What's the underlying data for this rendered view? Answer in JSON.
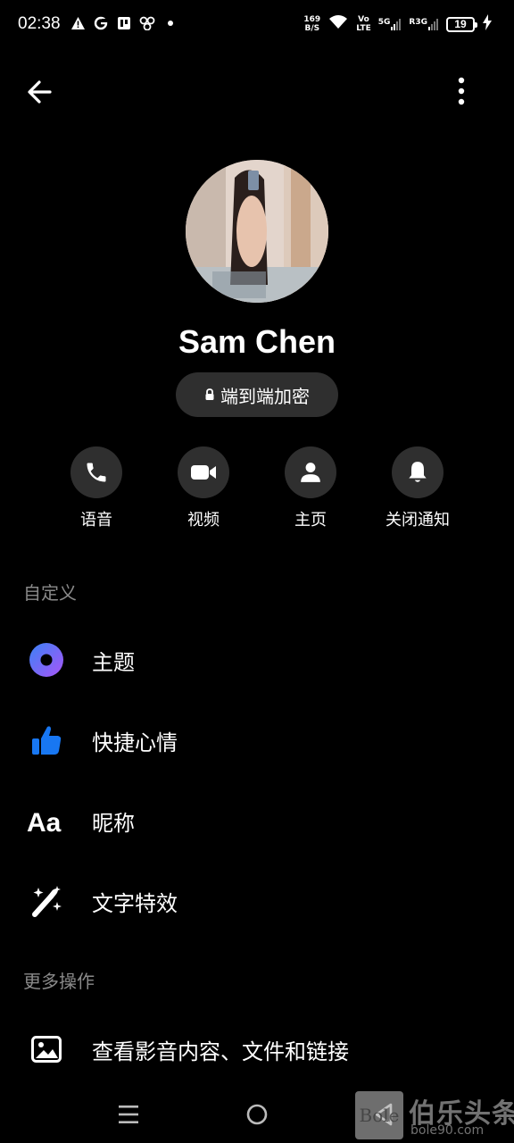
{
  "status_bar": {
    "time": "02:38",
    "net_speed_value": "169",
    "net_speed_unit": "B/S",
    "volte_top": "Vo",
    "volte_bottom": "LTE",
    "sim1_label": "5G",
    "sim2_label": "R3G",
    "battery_level": "19"
  },
  "profile": {
    "name": "Sam Chen",
    "encryption_label": "端到端加密"
  },
  "actions": [
    {
      "label": "语音",
      "icon": "phone-icon"
    },
    {
      "label": "视频",
      "icon": "video-camera-icon"
    },
    {
      "label": "主页",
      "icon": "person-icon"
    },
    {
      "label": "关闭通知",
      "icon": "bell-icon"
    }
  ],
  "sections": {
    "customize": {
      "header": "自定义",
      "items": [
        {
          "label": "主题",
          "icon": "theme-circle-icon"
        },
        {
          "label": "快捷心情",
          "icon": "thumbs-up-icon"
        },
        {
          "label": "昵称",
          "icon": "text-aa-icon"
        },
        {
          "label": "文字特效",
          "icon": "magic-wand-icon"
        }
      ]
    },
    "more": {
      "header": "更多操作",
      "items": [
        {
          "label": "查看影音内容、文件和链接",
          "icon": "image-icon"
        }
      ]
    }
  },
  "watermark": {
    "logo_text": "Bole",
    "title": "伯乐头条",
    "subtitle": "bole90.com"
  },
  "colors": {
    "background": "#000000",
    "button_bg": "#2f2f2f",
    "section_header": "#8a8a8a",
    "theme_gradient_start": "#3b82f6",
    "theme_gradient_end": "#a855f7",
    "like_blue": "#1877f2"
  }
}
